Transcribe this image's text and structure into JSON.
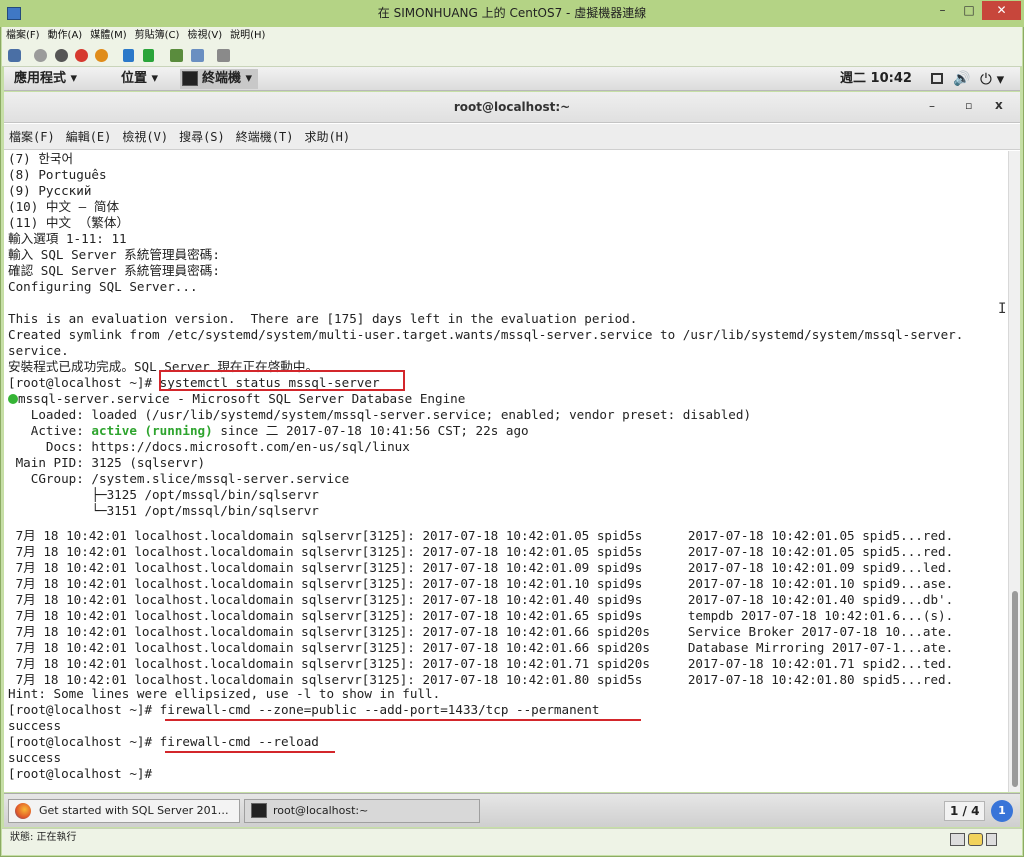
{
  "host": {
    "title": "在 SIMONHUANG 上的 CentOS7 - 虛擬機器連線",
    "controls": {
      "minimize": "–",
      "maximize": "□",
      "close": "✕"
    },
    "menu": [
      "檔案(F)",
      "動作(A)",
      "媒體(M)",
      "剪貼簿(C)",
      "檢視(V)",
      "說明(H)"
    ],
    "status": "狀態: 正在執行",
    "colors": {
      "frame": "#c6dfa6",
      "close": "#c7463b"
    }
  },
  "gnome": {
    "apps": "應用程式 ▾",
    "places": "位置 ▾",
    "terminal_app": "終端機 ▾",
    "clock": "週二 10:42",
    "volume_icon": "🔊",
    "power_icon": "⏻ ▾"
  },
  "terminal": {
    "title": "root@localhost:~",
    "controls": {
      "minimize": "–",
      "maximize": "▫",
      "close": "x"
    },
    "menu": [
      "檔案(F)",
      "編輯(E)",
      "檢視(V)",
      "搜尋(S)",
      "終端機(T)",
      "求助(H)"
    ],
    "ibeam": "I",
    "lines": [
      "(7) 한국어",
      "(8) Português",
      "(9) Русский",
      "(10) 中文 – 简体",
      "(11) 中文 （繁体）",
      "輸入選項 1-11: 11",
      "輸入 SQL Server 系統管理員密碼:",
      "確認 SQL Server 系統管理員密碼:",
      "Configuring SQL Server...",
      "",
      "This is an evaluation version.  There are [175] days left in the evaluation period.",
      "Created symlink from /etc/systemd/system/multi-user.target.wants/mssql-server.service to /usr/lib/systemd/system/mssql-server.",
      "service.",
      "安裝程式已成功完成。SQL Server 現在正在啓動中。"
    ],
    "cmd1_prompt": "[root@localhost ~]# ",
    "cmd1": "systemctl status mssql-server",
    "service_line": "mssql-server.service - Microsoft SQL Server Database Engine",
    "loaded": "   Loaded: loaded (/usr/lib/systemd/system/mssql-server.service; enabled; vendor preset: disabled)",
    "active_label": "   Active: ",
    "active_state": "active (running)",
    "active_since": " since 二 2017-07-18 10:41:56 CST; 22s ago",
    "status_lines": [
      "     Docs: https://docs.microsoft.com/en-us/sql/linux",
      " Main PID: 3125 (sqlservr)",
      "   CGroup: /system.slice/mssql-server.service",
      "           ├─3125 /opt/mssql/bin/sqlservr",
      "           └─3151 /opt/mssql/bin/sqlservr"
    ],
    "log_lines": [
      " 7月 18 10:42:01 localhost.localdomain sqlservr[3125]: 2017-07-18 10:42:01.05 spid5s      2017-07-18 10:42:01.05 spid5...red.",
      " 7月 18 10:42:01 localhost.localdomain sqlservr[3125]: 2017-07-18 10:42:01.05 spid5s      2017-07-18 10:42:01.05 spid5...red.",
      " 7月 18 10:42:01 localhost.localdomain sqlservr[3125]: 2017-07-18 10:42:01.09 spid9s      2017-07-18 10:42:01.09 spid9...led.",
      " 7月 18 10:42:01 localhost.localdomain sqlservr[3125]: 2017-07-18 10:42:01.10 spid9s      2017-07-18 10:42:01.10 spid9...ase.",
      " 7月 18 10:42:01 localhost.localdomain sqlservr[3125]: 2017-07-18 10:42:01.40 spid9s      2017-07-18 10:42:01.40 spid9...db'.",
      " 7月 18 10:42:01 localhost.localdomain sqlservr[3125]: 2017-07-18 10:42:01.65 spid9s      tempdb 2017-07-18 10:42:01.6...(s).",
      " 7月 18 10:42:01 localhost.localdomain sqlservr[3125]: 2017-07-18 10:42:01.66 spid20s     Service Broker 2017-07-18 10...ate.",
      " 7月 18 10:42:01 localhost.localdomain sqlservr[3125]: 2017-07-18 10:42:01.66 spid20s     Database Mirroring 2017-07-1...ate.",
      " 7月 18 10:42:01 localhost.localdomain sqlservr[3125]: 2017-07-18 10:42:01.71 spid20s     2017-07-18 10:42:01.71 spid2...ted.",
      " 7月 18 10:42:01 localhost.localdomain sqlservr[3125]: 2017-07-18 10:42:01.80 spid5s      2017-07-18 10:42:01.80 spid5...red."
    ],
    "hint": "Hint: Some lines were ellipsized, use -l to show in full.",
    "cmd2_prompt": "[root@localhost ~]# ",
    "cmd2": "firewall-cmd --zone=public --add-port=1433/tcp --permanent",
    "cmd2_result": "success",
    "cmd3_prompt": "[root@localhost ~]# ",
    "cmd3": "firewall-cmd --reload",
    "cmd3_result": "success",
    "final_prompt": "[root@localhost ~]#",
    "colors": {
      "highlight": "#d3262b",
      "running": "#2ea42e"
    }
  },
  "taskbar": {
    "firefox": "Get started with SQL Server 201…",
    "terminal": "root@localhost:~",
    "workspace": "1 / 4",
    "workspace_badge": "1"
  }
}
